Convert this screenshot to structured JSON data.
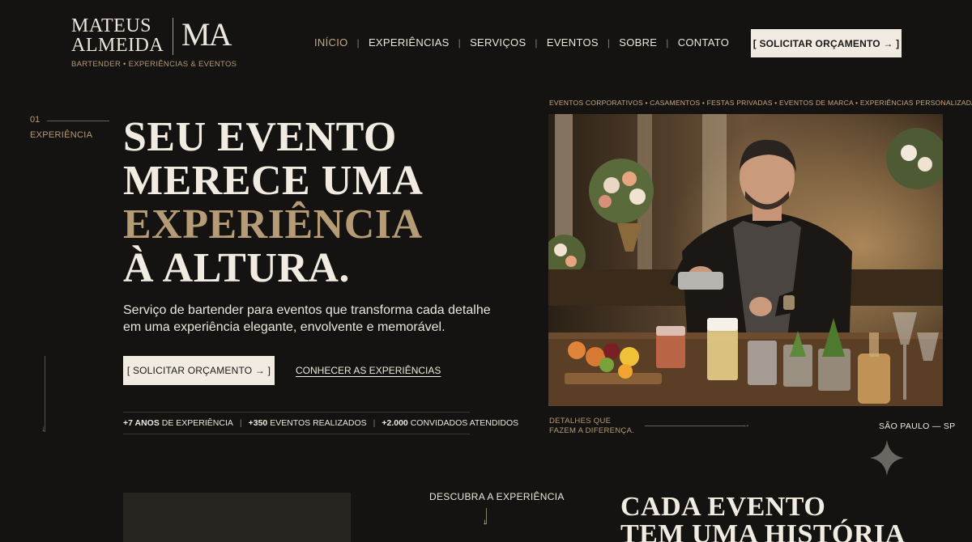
{
  "brand": {
    "name_line1": "MATEUS",
    "name_line2": "ALMEIDA",
    "monogram": "MA",
    "tagline": "BARTENDER • EXPERIÊNCIAS & EVENTOS"
  },
  "nav": {
    "items": [
      {
        "label": "INÍCIO",
        "active": true
      },
      {
        "label": "EXPERIÊNCIAS",
        "active": false
      },
      {
        "label": "SERVIÇOS",
        "active": false
      },
      {
        "label": "EVENTOS",
        "active": false
      },
      {
        "label": "SOBRE",
        "active": false
      },
      {
        "label": "CONTATO",
        "active": false
      }
    ],
    "separator": "|",
    "cta_label": "[ SOLICITAR ORÇAMENTO → ]"
  },
  "hero": {
    "index_number": "01",
    "index_label": "EXPERIÊNCIA",
    "title_line1": "SEU EVENTO",
    "title_line2": "MERECE UMA",
    "title_line3": "EXPERIÊNCIA",
    "title_line4": "À ALTURA.",
    "subtitle": "Serviço de bartender para eventos que transforma cada detalhe em uma experiência elegante, envolvente e memorável.",
    "cta_label": "[ SOLICITAR ORÇAMENTO → ]",
    "link_label": "CONHECER AS EXPERIÊNCIAS",
    "stats": [
      {
        "value": "+7 ANOS",
        "label": "DE EXPERIÊNCIA"
      },
      {
        "value": "+350",
        "label": "EVENTOS REALIZADOS"
      },
      {
        "value": "+2.000",
        "label": "CONVIDADOS ATENDIDOS"
      }
    ]
  },
  "showcase": {
    "categories": "EVENTOS CORPORATIVOS • CASAMENTOS • FESTAS PRIVADAS • EVENTOS DE MARCA • EXPERIÊNCIAS PERSONALIZADAS",
    "details_line1": "DETALHES QUE",
    "details_line2": "FAZEM A DIFERENÇA.",
    "location": "SÃO PAULO — SP"
  },
  "next_section": {
    "discover_label": "DESCUBRA A EXPERIÊNCIA",
    "title_line1": "CADA EVENTO",
    "title_line2": "TEM UMA HISTÓRIA"
  },
  "colors": {
    "background": "#141311",
    "gold_accent": "#b59b76",
    "cream": "#f1ebe1"
  },
  "icons": [
    "arrow-right-icon",
    "arrow-down-icon",
    "sparkle-icon"
  ]
}
